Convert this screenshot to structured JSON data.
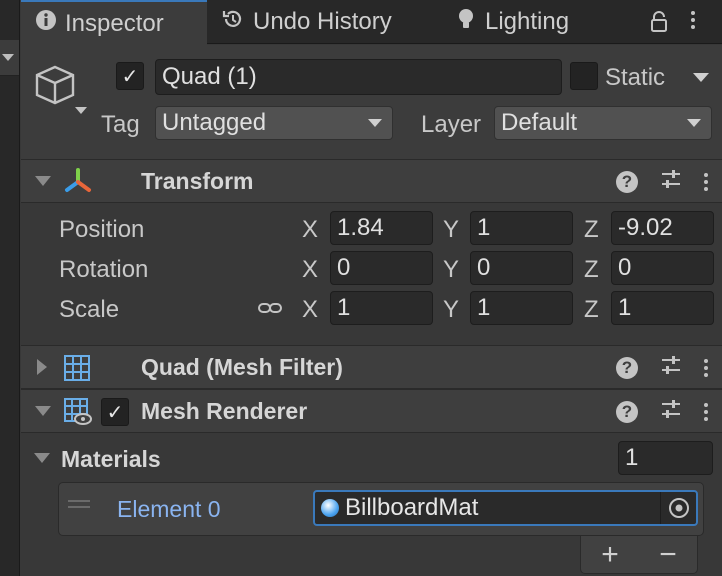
{
  "tabs": [
    {
      "label": "Inspector",
      "icon": "info-icon"
    },
    {
      "label": "Undo History",
      "icon": "history-icon"
    },
    {
      "label": "Lighting",
      "icon": "bulb-icon"
    }
  ],
  "object": {
    "name": "Quad (1)",
    "enabled": true,
    "static_label": "Static",
    "tag_label": "Tag",
    "tag_value": "Untagged",
    "layer_label": "Layer",
    "layer_value": "Default"
  },
  "transform": {
    "title": "Transform",
    "rows": [
      {
        "label": "Position",
        "x": "1.84",
        "y": "1",
        "z": "-9.02"
      },
      {
        "label": "Rotation",
        "x": "0",
        "y": "0",
        "z": "0"
      },
      {
        "label": "Scale",
        "x": "1",
        "y": "1",
        "z": "1"
      }
    ],
    "axes": [
      "X",
      "Y",
      "Z"
    ]
  },
  "mesh_filter": {
    "title": "Quad (Mesh Filter)"
  },
  "mesh_renderer": {
    "title": "Mesh Renderer",
    "enabled": true
  },
  "materials": {
    "label": "Materials",
    "count": "1",
    "elements": [
      {
        "label": "Element 0",
        "value": "BillboardMat"
      }
    ],
    "add_label": "+",
    "remove_label": "−"
  },
  "colors": {
    "accent": "#3a79bb",
    "element_label": "#8ab4f0"
  }
}
